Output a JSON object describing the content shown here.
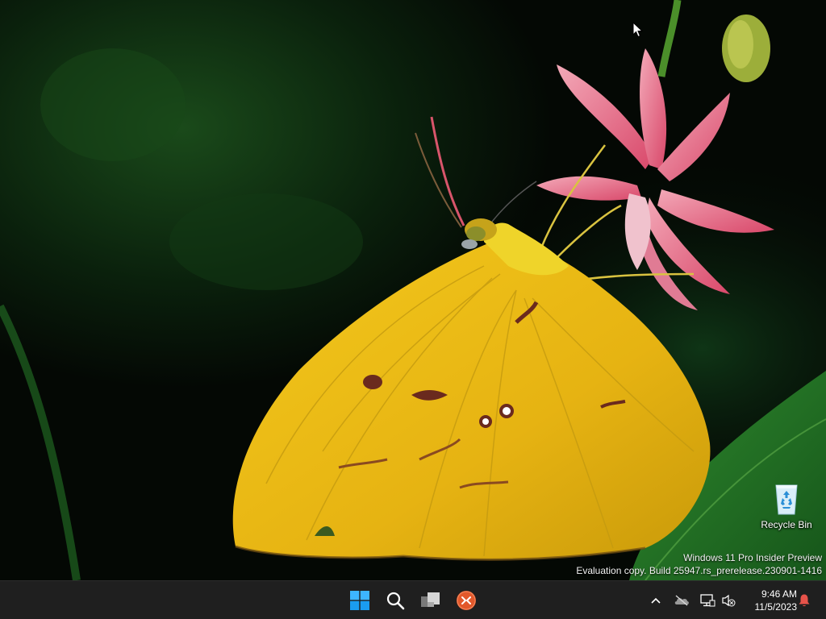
{
  "desktop": {
    "icons": [
      {
        "label": "Recycle Bin",
        "icon": "recycle-bin-icon"
      }
    ],
    "watermark": {
      "line1": "Windows 11 Pro Insider Preview",
      "line2": "Evaluation copy. Build 25947.rs_prerelease.230901-1416"
    }
  },
  "taskbar": {
    "apps": [
      {
        "name": "Start",
        "icon": "windows-logo-icon"
      },
      {
        "name": "Search",
        "icon": "search-icon"
      },
      {
        "name": "Task View",
        "icon": "task-view-icon"
      },
      {
        "name": "Remote Desktop",
        "icon": "remote-desktop-icon"
      }
    ],
    "tray": {
      "icons": [
        "chevron-up-icon",
        "onedrive-icon",
        "network-icon",
        "volume-muted-icon"
      ],
      "time": "9:46 AM",
      "date": "11/5/2023",
      "notification_icon": "bell-icon"
    }
  },
  "colors": {
    "taskbar_bg": "#1f1f1f",
    "start_blue": "#1a9cf0",
    "rdp_orange": "#e2582b",
    "notification_red": "#e8534a"
  }
}
